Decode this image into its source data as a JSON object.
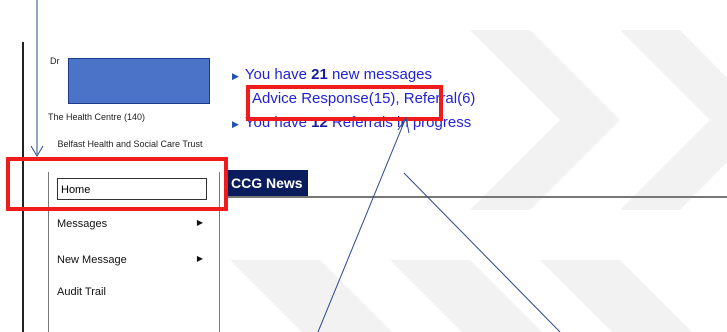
{
  "sidebar": {
    "user_trunc": "Dr",
    "practice": "The Health Centre (140)",
    "trust": "Belfast Health and Social Care Trust",
    "home_value": "Home",
    "menu": [
      {
        "label": "Messages",
        "has_submenu": true
      },
      {
        "label": "New Message",
        "has_submenu": true
      },
      {
        "label": "Audit Trail",
        "has_submenu": false
      }
    ]
  },
  "messages": {
    "line1_prefix": "You have",
    "line1_count": "21",
    "line1_suffix": "new messages",
    "line2": "Advice Response(15), Referral(6)",
    "line3_prefix": "You have",
    "line3_count": "12",
    "line3_suffix": "Referrals in progress"
  },
  "news": {
    "title": "CCG News"
  },
  "colors": {
    "link": "#1f1fd6",
    "highlight": "#ee1c1c",
    "news_bar": "#0a1c5c"
  }
}
